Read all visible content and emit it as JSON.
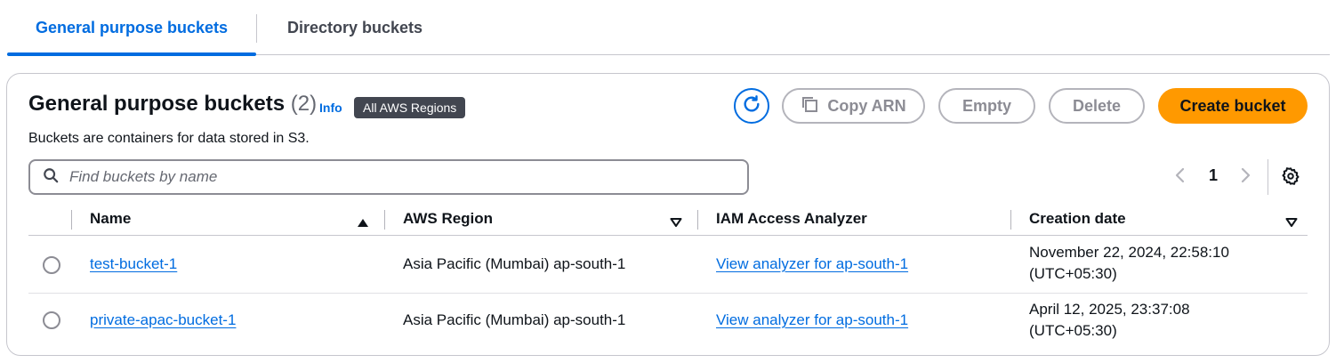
{
  "tabs": [
    {
      "label": "General purpose buckets",
      "active": true
    },
    {
      "label": "Directory buckets",
      "active": false
    }
  ],
  "header": {
    "title": "General purpose buckets",
    "count": "(2)",
    "info": "Info",
    "region_badge": "All AWS Regions",
    "description": "Buckets are containers for data stored in S3."
  },
  "actions": {
    "copy_arn": "Copy ARN",
    "empty": "Empty",
    "delete": "Delete",
    "create": "Create bucket"
  },
  "search": {
    "placeholder": "Find buckets by name",
    "value": ""
  },
  "pagination": {
    "current_page": "1"
  },
  "table": {
    "columns": [
      "Name",
      "AWS Region",
      "IAM Access Analyzer",
      "Creation date"
    ],
    "rows": [
      {
        "name": "test-bucket-1",
        "region": "Asia Pacific (Mumbai) ap-south-1",
        "analyzer": "View analyzer for ap-south-1",
        "date_line1": "November 22, 2024, 22:58:10",
        "date_line2": "(UTC+05:30)"
      },
      {
        "name": "private-apac-bucket-1",
        "region": "Asia Pacific (Mumbai) ap-south-1",
        "analyzer": "View analyzer for ap-south-1",
        "date_line1": "April 12, 2025, 23:37:08",
        "date_line2": "(UTC+05:30)"
      }
    ]
  },
  "colors": {
    "accent": "#006ce0",
    "primary_button": "#ff9900",
    "badge_bg": "#424650",
    "disabled": "#8c8c94"
  },
  "icons": [
    "refresh-icon",
    "copy-icon",
    "search-icon",
    "chevron-left-icon",
    "chevron-right-icon",
    "gear-icon",
    "sort-ascending-icon",
    "sort-descending-icon"
  ]
}
